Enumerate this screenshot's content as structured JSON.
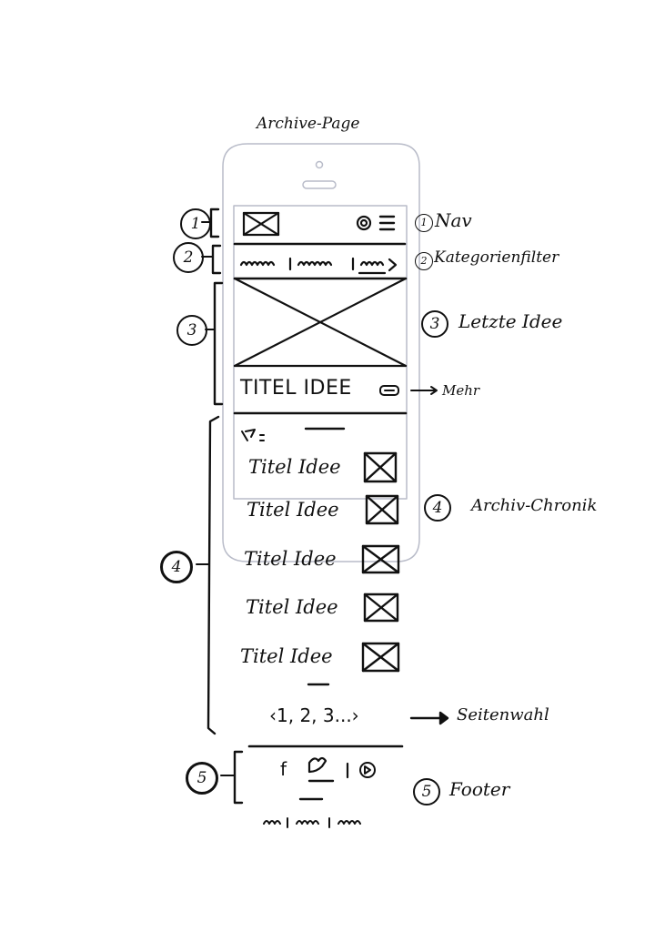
{
  "title": "Archive-Page",
  "nav": {
    "number": "1",
    "label": "Nav",
    "annotation_number": "1"
  },
  "filter": {
    "number": "2",
    "label": "Kategorienfilter",
    "annotation_number": "2"
  },
  "latest": {
    "number": "3",
    "label": "Letzte Idee",
    "annotation_number": "3",
    "item_title": "TITEL IDEE",
    "more_label": "Mehr"
  },
  "archive": {
    "number": "4",
    "label": "Archiv-Chronik",
    "annotation_number": "4",
    "items": [
      "Titel Idee",
      "Titel Idee",
      "Titel Idee",
      "Titel Idee",
      "Titel Idee"
    ],
    "pager": "‹1, 2, 3...›",
    "pager_label": "Seitenwahl"
  },
  "footer": {
    "number": "5",
    "label": "Footer",
    "annotation_number": "5",
    "social": "f"
  }
}
